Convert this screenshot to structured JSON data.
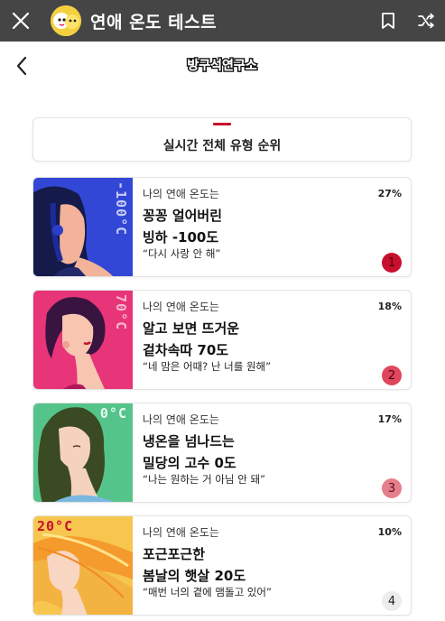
{
  "topbar": {
    "title": "연애 온도 테스트"
  },
  "icons": {
    "close": "close-icon",
    "avatar": "character-avatar-icon",
    "bookmark": "bookmark-icon",
    "shuffle": "shuffle-icon",
    "back": "chevron-left-icon",
    "logo": "brand-logo"
  },
  "brand_logo_text": "방구석연구소",
  "section": {
    "title": "실시간 전체 유형 순위"
  },
  "ranks": [
    {
      "intro": "나의 연애 온도는",
      "name_line1": "꽁꽁 얼어버린",
      "name_line2": "빙하 -100도",
      "quote": "“다시 사랑 안 해”",
      "percent": "27%",
      "rank": "1",
      "thumb_temp": "-100°C",
      "thumb_bg": "#3347d6",
      "badge_bg": "#c8102e",
      "badge_color": "#4a0008"
    },
    {
      "intro": "나의 연애 온도는",
      "name_line1": "알고 보면 뜨거운",
      "name_line2": "겉차속따 70도",
      "quote": "“네 맘은 어때? 난 너를 원해”",
      "percent": "18%",
      "rank": "2",
      "thumb_temp": "70°C",
      "thumb_bg": "#e83478",
      "badge_bg": "#e0475c",
      "badge_color": "#4a0010"
    },
    {
      "intro": "나의 연애 온도는",
      "name_line1": "냉온을 넘나드는",
      "name_line2": "밀당의 고수 0도",
      "quote": "“나는 원하는 거 아님 안 돼”",
      "percent": "17%",
      "rank": "3",
      "thumb_temp": "0°C",
      "thumb_bg": "#55c48a",
      "badge_bg": "#e57f8b",
      "badge_color": "#5a1020"
    },
    {
      "intro": "나의 연애 온도는",
      "name_line1": "포근포근한",
      "name_line2": "봄날의 햇살 20도",
      "quote": "“매번 너의 곁에 맴돌고 있어”",
      "percent": "10%",
      "rank": "4",
      "thumb_temp": "20°C",
      "thumb_bg": "#f7c64e",
      "badge_bg": "#ececec",
      "badge_color": "#222222"
    }
  ]
}
